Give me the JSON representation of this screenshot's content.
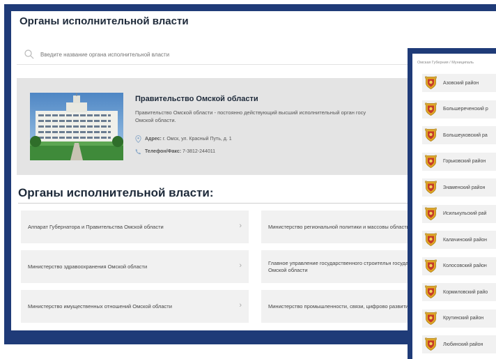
{
  "portal": {
    "title": "Органы исполнительной власти",
    "search_placeholder": "Введите название органа исполнительной власти"
  },
  "government": {
    "name": "Правительство Омской области",
    "description": "Правительство Омской области - постоянно действующий высший исполнительный орган госу",
    "description_cont": "Омской области.",
    "address_label": "Адрес:",
    "address_value": "г. Омск, ул. Красный Путь, д. 1",
    "phone_label": "Телефон/Факс:",
    "phone_value": "7-3812-244011"
  },
  "section_title": "Органы исполнительной власти:",
  "bodies": [
    {
      "label": "Аппарат Губернатора и Правительства Омской области"
    },
    {
      "label": "Министерство региональной политики и массовы области"
    },
    {
      "label": "Министерство здравоохранения Омской области"
    },
    {
      "label": "Главное управление государственного строительн государственной экспертизы Омской области"
    },
    {
      "label": "Министерство имущественных отношений Омской области"
    },
    {
      "label": "Министерство промышленности, связи, цифрово развития Омской области"
    }
  ],
  "municipal": {
    "breadcrumb": "Омская Губерния / Муниципаль",
    "districts": [
      {
        "label": "Азовский район"
      },
      {
        "label": "Большереченский р"
      },
      {
        "label": "Большеуковский ра"
      },
      {
        "label": "Горьковский район"
      },
      {
        "label": "Знаменский район"
      },
      {
        "label": "Исилькульский рай"
      },
      {
        "label": "Калачинский район"
      },
      {
        "label": "Колосовский район"
      },
      {
        "label": "Кормиловский райо"
      },
      {
        "label": "Крутинский район"
      },
      {
        "label": "Любинский район"
      }
    ]
  },
  "colors": {
    "window_frame": "#1f3b78",
    "card_bg": "#e4e4e4",
    "tile_bg": "#f1f1f1",
    "heading": "#1e2a3a",
    "emblem_gold": "#e0a826",
    "emblem_red": "#c53b2a"
  },
  "icons": {
    "search": "search-icon",
    "address": "location-pin-icon",
    "phone": "phone-icon",
    "chevron": "chevron-right-icon",
    "district_emblem": "coat-of-arms-icon"
  }
}
